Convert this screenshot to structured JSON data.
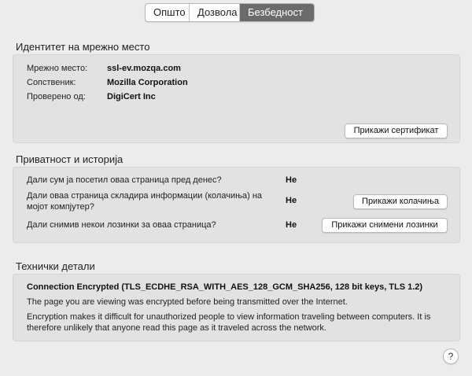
{
  "tabs": [
    {
      "label": "Општо",
      "active": false
    },
    {
      "label": "Дозвола",
      "active": false
    },
    {
      "label": "Безбедност",
      "active": true
    }
  ],
  "identity": {
    "title": "Идентитет на мрежно место",
    "rows": [
      {
        "label": "Мрежно место:",
        "value": "ssl-ev.mozqa.com"
      },
      {
        "label": "Сопственик:",
        "value": "Mozilla Corporation"
      },
      {
        "label": "Проверено од:",
        "value": "DigiCert Inc"
      }
    ],
    "view_cert_button": "Прикажи сертификат"
  },
  "privacy": {
    "title": "Приватност и историја",
    "rows": [
      {
        "question": "Дали сум ја посетил оваа страница пред денес?",
        "answer": "Не"
      },
      {
        "question": "Дали оваа страница складира информации (колачиња) на мојот компјутер?",
        "answer": "Не",
        "button": "Прикажи колачиња"
      },
      {
        "question": "Дали снимив некои лозинки за оваа страница?",
        "answer": "Не",
        "button": "Прикажи снимени лозинки"
      }
    ]
  },
  "technical": {
    "title": "Технички детали",
    "headline": "Connection Encrypted (TLS_ECDHE_RSA_WITH_AES_128_GCM_SHA256, 128 bit keys, TLS 1.2)",
    "line1": "The page you are viewing was encrypted before being transmitted over the Internet.",
    "line2": "Encryption makes it difficult for unauthorized people to view information traveling between computers. It is therefore unlikely that anyone read this page as it traveled across the network."
  },
  "help_label": "?"
}
